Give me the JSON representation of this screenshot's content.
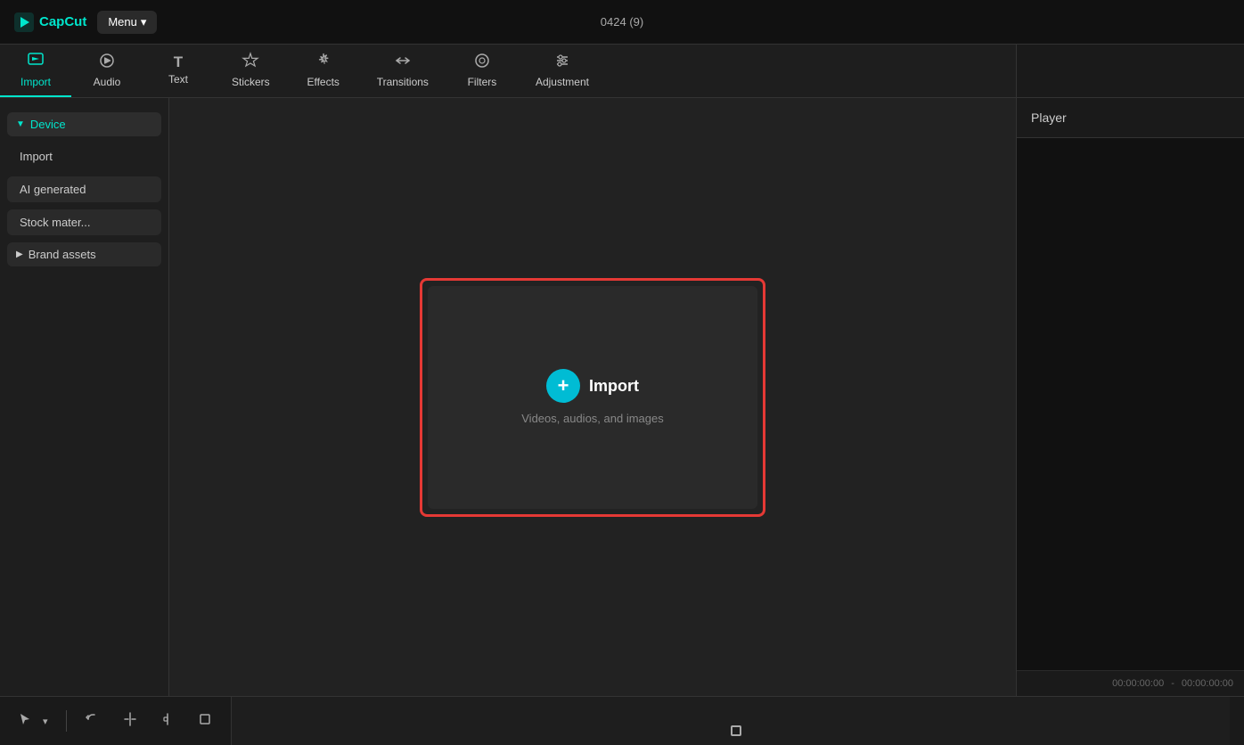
{
  "topbar": {
    "logo_text": "CapCut",
    "menu_label": "Menu",
    "menu_arrow": "▾",
    "project_id": "0424 (9)"
  },
  "toolbar": {
    "tabs": [
      {
        "id": "import",
        "label": "Import",
        "icon": "▶",
        "active": true
      },
      {
        "id": "audio",
        "label": "Audio",
        "icon": "♪",
        "active": false
      },
      {
        "id": "text",
        "label": "Text",
        "icon": "T",
        "active": false
      },
      {
        "id": "stickers",
        "label": "Stickers",
        "icon": "✦",
        "active": false
      },
      {
        "id": "effects",
        "label": "Effects",
        "icon": "❋",
        "active": false
      },
      {
        "id": "transitions",
        "label": "Transitions",
        "icon": "⇌",
        "active": false
      },
      {
        "id": "filters",
        "label": "Filters",
        "icon": "◎",
        "active": false
      },
      {
        "id": "adjustment",
        "label": "Adjustment",
        "icon": "⚙",
        "active": false
      }
    ]
  },
  "sidebar": {
    "device_label": "Device",
    "import_item": "Import",
    "ai_generated_label": "AI generated",
    "stock_material_label": "Stock mater...",
    "brand_assets_label": "Brand assets"
  },
  "import_zone": {
    "button_label": "+",
    "title": "Import",
    "subtitle": "Videos, audios, and images"
  },
  "player": {
    "title": "Player",
    "timecode_start": "00:00:00:00",
    "timecode_end": "00:00:00:00"
  },
  "timeline": {
    "tools": [
      "↺",
      "⇄",
      "⌶",
      "⌷",
      "▣"
    ],
    "playhead_icon": "◇"
  }
}
